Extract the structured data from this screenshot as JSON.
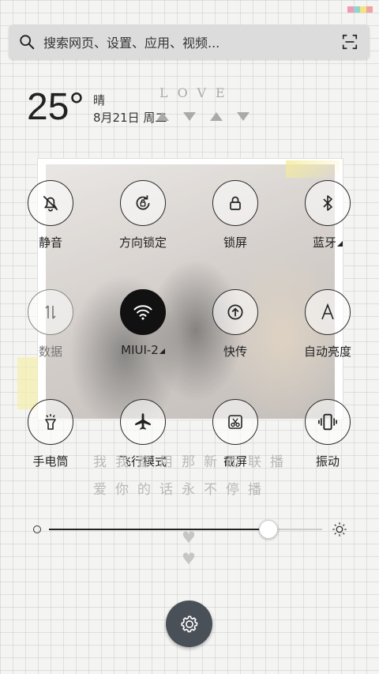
{
  "status_colors": [
    "#f29ab3",
    "#8fd6d1",
    "#f4e47a",
    "#f2a0a0"
  ],
  "search": {
    "placeholder": "搜索网页、设置、应用、视频..."
  },
  "weather": {
    "temperature": "25°",
    "condition": "晴",
    "date": "8月21日 周二"
  },
  "wallpaper": {
    "love_text": "LOVE",
    "lyrics_line1": "我我都用那新而联播",
    "lyrics_line2": "爱你的话永不停播"
  },
  "toggles": [
    {
      "label": "静音",
      "icon": "bell-off-icon",
      "state": "off"
    },
    {
      "label": "方向锁定",
      "icon": "rotation-lock-icon",
      "state": "off"
    },
    {
      "label": "锁屏",
      "icon": "lock-icon",
      "state": "off"
    },
    {
      "label": "蓝牙",
      "icon": "bluetooth-icon",
      "state": "off",
      "has_submenu": true
    },
    {
      "label": "数据",
      "icon": "mobile-data-icon",
      "state": "disabled"
    },
    {
      "label": "MIUI-2",
      "icon": "wifi-icon",
      "state": "on",
      "has_submenu": true
    },
    {
      "label": "快传",
      "icon": "quick-transfer-icon",
      "state": "off"
    },
    {
      "label": "自动亮度",
      "icon": "auto-brightness-icon",
      "state": "off"
    },
    {
      "label": "手电筒",
      "icon": "flashlight-icon",
      "state": "off"
    },
    {
      "label": "飞行模式",
      "icon": "airplane-icon",
      "state": "off"
    },
    {
      "label": "截屏",
      "icon": "screenshot-icon",
      "state": "off"
    },
    {
      "label": "振动",
      "icon": "vibrate-icon",
      "state": "off"
    }
  ],
  "brightness": {
    "level_fraction": 0.8
  },
  "colors": {
    "active_toggle": "#111111",
    "settings_button": "#4a5058"
  }
}
